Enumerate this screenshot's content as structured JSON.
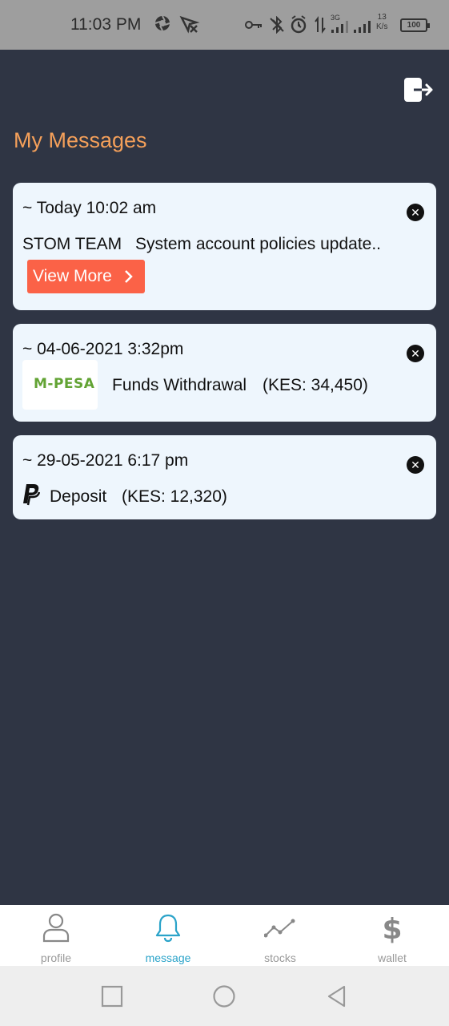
{
  "status_bar": {
    "time": "11:03 PM",
    "net_speed_value": "13",
    "net_speed_unit": "K/s",
    "network_type": "3G",
    "battery": "100",
    "icons": [
      "aperture-icon",
      "location-off-icon",
      "key-icon",
      "bluetooth-off-icon",
      "alarm-icon",
      "data-transfer-icon",
      "signal-icon",
      "signal-icon",
      "battery-icon"
    ]
  },
  "header": {
    "title": "My Messages",
    "logout_icon": "logout-icon"
  },
  "messages": [
    {
      "date": "~ Today 10:02 am",
      "sender": "STOM TEAM",
      "text": "System account policies update..",
      "button": "View More"
    },
    {
      "date": "~ 04-06-2021 3:32pm",
      "logo": "M-PESA",
      "text": "Funds Withdrawal",
      "amount": "(KES: 34,450)"
    },
    {
      "date": "~ 29-05-2021 6:17 pm",
      "logo_icon": "paypal-icon",
      "text": "Deposit",
      "amount": "(KES: 12,320)"
    }
  ],
  "bottom_nav": [
    {
      "label": "profile",
      "icon": "user-icon"
    },
    {
      "label": "message",
      "icon": "bell-icon",
      "active": true
    },
    {
      "label": "stocks",
      "icon": "chart-line-icon"
    },
    {
      "label": "wallet",
      "icon": "dollar-icon"
    }
  ],
  "colors": {
    "background": "#2f3544",
    "title": "#f5a05a",
    "card": "#eef6fd",
    "accent_button": "#fb6247",
    "active_nav": "#2aa3c9",
    "mpesa_green": "#62a334"
  }
}
